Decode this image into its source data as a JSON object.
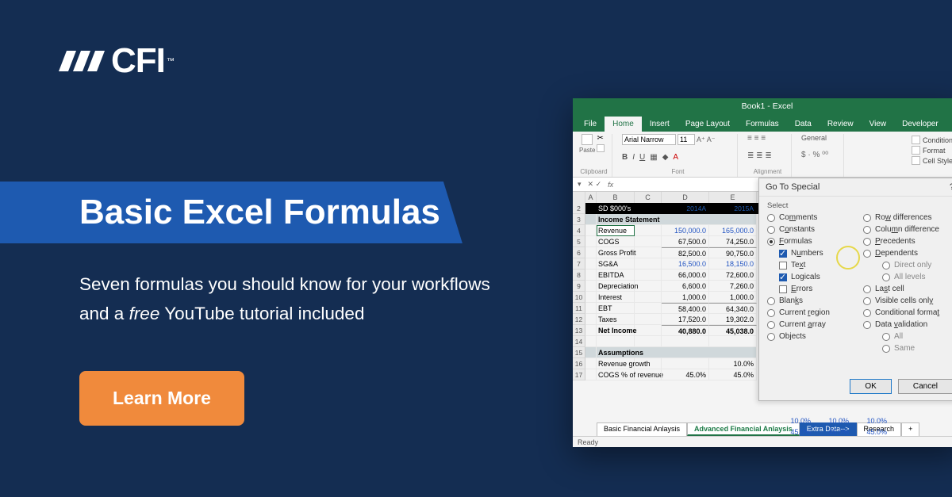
{
  "logo": {
    "text": "CFI",
    "tm": "™"
  },
  "hero": {
    "title": "Basic Excel Formulas",
    "subtitle_pre": "Seven formulas you should know for your workflows and a ",
    "subtitle_em": "free",
    "subtitle_post": " YouTube tutorial included",
    "cta": "Learn More"
  },
  "excel": {
    "window_title": "Book1 - Excel",
    "tabs": [
      "File",
      "Home",
      "Insert",
      "Page Layout",
      "Formulas",
      "Data",
      "Review",
      "View",
      "Developer"
    ],
    "active_tab": "Home",
    "ribbon": {
      "clipboard_label": "Clipboard",
      "paste": "Paste",
      "font_label": "Font",
      "font_name": "Arial Narrow",
      "font_size": "11",
      "alignment_label": "Alignment",
      "number_format": "General",
      "cond_formatting": "Conditional",
      "format_table": "Format",
      "cell_styles": "Cell Styles"
    },
    "fxbar": {
      "fx": "fx"
    },
    "columns": [
      "A",
      "B",
      "C",
      "D",
      "E"
    ],
    "header_left": "SD $000's",
    "header_years": [
      "2014A",
      "2015A"
    ],
    "rows": [
      {
        "n": 3,
        "section": "Income Statement"
      },
      {
        "n": 4,
        "b": "Revenue",
        "d": "150,000.0",
        "e": "165,000.0",
        "blue": true
      },
      {
        "n": 5,
        "b": "COGS",
        "d": "67,500.0",
        "e": "74,250.0"
      },
      {
        "n": 6,
        "b": "Gross Profit",
        "d": "82,500.0",
        "e": "90,750.0",
        "ul": true
      },
      {
        "n": 7,
        "b": "SG&A",
        "d": "16,500.0",
        "e": "18,150.0",
        "blue": true
      },
      {
        "n": 8,
        "b": "EBITDA",
        "d": "66,000.0",
        "e": "72,600.0"
      },
      {
        "n": 9,
        "b": "Depreciation",
        "d": "6,600.0",
        "e": "7,260.0"
      },
      {
        "n": 10,
        "b": "Interest",
        "d": "1,000.0",
        "e": "1,000.0"
      },
      {
        "n": 11,
        "b": "EBT",
        "d": "58,400.0",
        "e": "64,340.0",
        "ul": true
      },
      {
        "n": 12,
        "b": "Taxes",
        "d": "17,520.0",
        "e": "19,302.0"
      },
      {
        "n": 13,
        "b": "Net Income",
        "d": "40,880.0",
        "e": "45,038.0",
        "bold": true,
        "ul": true
      },
      {
        "n": 14,
        "b": ""
      },
      {
        "n": 15,
        "section": "Assumptions"
      },
      {
        "n": 16,
        "b": "Revenue growth",
        "d": "",
        "e": "10.0%"
      },
      {
        "n": 17,
        "b": "COGS % of revenue",
        "d": "45.0%",
        "e": "45.0%"
      }
    ],
    "hidden_ext": {
      "p10": "10.0%",
      "p45": "45.0%"
    },
    "sheets": [
      "Basic Financial Anlaysis",
      "Advanced Financial Anlaysis",
      "Extra Data-->",
      "Research"
    ],
    "sheets_add": "+",
    "status": "Ready"
  },
  "dialog": {
    "title": "Go To Special",
    "help": "?",
    "section": "Select",
    "left": [
      {
        "label_pre": "Co",
        "u": "m",
        "label_post": "ments",
        "type": "radio"
      },
      {
        "label_pre": "C",
        "u": "o",
        "label_post": "nstants",
        "type": "radio"
      },
      {
        "u": "F",
        "label_post": "ormulas",
        "type": "radio",
        "on": true
      },
      {
        "label_pre": "N",
        "u": "u",
        "label_post": "mbers",
        "type": "check",
        "on": true,
        "indent": true,
        "blue": true
      },
      {
        "label_pre": "Te",
        "u": "x",
        "label_post": "t",
        "type": "check",
        "indent": true
      },
      {
        "label_pre": "Lo",
        "u": "g",
        "label_post": "icals",
        "type": "check",
        "on": true,
        "indent": true,
        "blue": true
      },
      {
        "u": "E",
        "label_post": "rrors",
        "type": "check",
        "indent": true
      },
      {
        "label_pre": "Blan",
        "u": "k",
        "label_post": "s",
        "type": "radio"
      },
      {
        "label_pre": "Current ",
        "u": "r",
        "label_post": "egion",
        "type": "radio"
      },
      {
        "label_pre": "Current ",
        "u": "a",
        "label_post": "rray",
        "type": "radio"
      },
      {
        "label_pre": "Ob",
        "u": "j",
        "label_post": "ects",
        "type": "radio"
      }
    ],
    "right": [
      {
        "label_pre": "Ro",
        "u": "w",
        "label_post": " differences",
        "type": "radio"
      },
      {
        "label_pre": "Colu",
        "u": "m",
        "label_post": "n difference",
        "type": "radio"
      },
      {
        "u": "P",
        "label_post": "recedents",
        "type": "radio"
      },
      {
        "u": "D",
        "label_post": "ependents",
        "type": "radio"
      },
      {
        "label": "Direct only",
        "type": "radio",
        "indent2": true
      },
      {
        "label": "All levels",
        "type": "radio",
        "indent2": true
      },
      {
        "label_pre": "La",
        "u": "s",
        "label_post": "t cell",
        "type": "radio"
      },
      {
        "label_pre": "Visible cells onl",
        "u": "y",
        "type": "radio"
      },
      {
        "label_pre": "Conditional forma",
        "u": "t",
        "type": "radio"
      },
      {
        "label_pre": "Data ",
        "u": "v",
        "label_post": "alidation",
        "type": "radio"
      },
      {
        "label": "All",
        "type": "radio",
        "indent2": true
      },
      {
        "label": "Same",
        "type": "radio",
        "indent2": true
      }
    ],
    "ok": "OK",
    "cancel": "Cancel"
  }
}
